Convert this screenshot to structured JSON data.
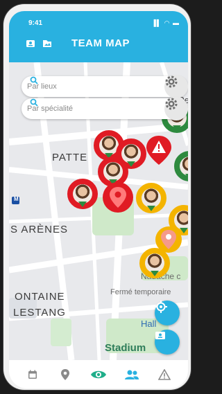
{
  "status": {
    "time": "9:41",
    "icons": "▐▌ ◠ ▬"
  },
  "header": {
    "title": "TEAM MAP"
  },
  "search": {
    "places_placeholder": "Par lieux",
    "speciality_placeholder": "Par spécialité"
  },
  "map_labels": {
    "patte": "PATTE",
    "arenes": "S ARÈNES",
    "fontaine": "ONTAINE",
    "lestang": "LESTANG",
    "naduche": "Nadache c",
    "ferme": "Fermé temporaire",
    "stadium": "Stadium",
    "hall": "Hall",
    "metro": "M",
    "pe": "Pe"
  },
  "colors": {
    "accent": "#29b1e0",
    "pin_red": "#e01b24",
    "pin_yellow": "#f4b400",
    "pin_green": "#2e8a3f"
  },
  "nav": [
    "calendar-icon",
    "location-pin-icon",
    "eye-icon",
    "team-icon",
    "warning-icon"
  ]
}
